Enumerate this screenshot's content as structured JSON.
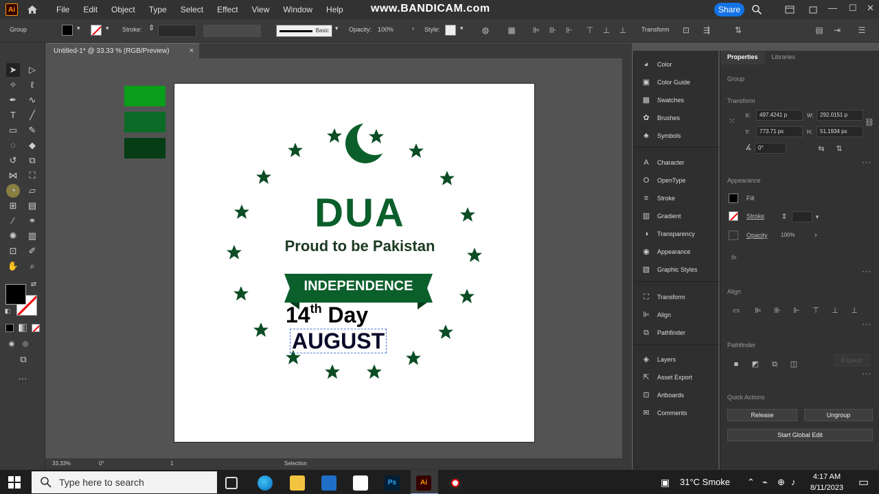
{
  "app": {
    "logo": "Ai",
    "menu": [
      "File",
      "Edit",
      "Object",
      "Type",
      "Select",
      "Effect",
      "View",
      "Window",
      "Help"
    ],
    "watermark": "www.BANDICAM.com",
    "share": "Share"
  },
  "control": {
    "selection": "Group",
    "stroke_label": "Stroke:",
    "brush": "Basic",
    "opacity_label": "Opacity:",
    "opacity": "100%",
    "style_label": "Style:",
    "transform": "Transform"
  },
  "document": {
    "tab_title": "Untitled-1* @ 33.33 % (RGB/Preview)",
    "close": "×"
  },
  "artwork": {
    "title": "DUA",
    "subtitle": "Proud to be Pakistan",
    "banner": "INDEPENDENCE",
    "day_number": "14",
    "day_suffix": "th",
    "day_word": "Day",
    "month": "AUGUST",
    "colors": {
      "green": "#0b5f2b",
      "swatch1": "#0a9d1a",
      "swatch2": "#0c6b27",
      "swatch3": "#063d15"
    }
  },
  "status": {
    "zoom": "33.33%",
    "rotation": "0°",
    "artboard": "1",
    "tool": "Selection"
  },
  "panels": [
    {
      "icon": "color-icon",
      "label": "Color"
    },
    {
      "icon": "color-guide-icon",
      "label": "Color Guide"
    },
    {
      "icon": "swatches-icon",
      "label": "Swatches"
    },
    {
      "icon": "brushes-icon",
      "label": "Brushes"
    },
    {
      "icon": "symbols-icon",
      "label": "Symbols"
    },
    {
      "icon": "character-icon",
      "label": "Character"
    },
    {
      "icon": "opentype-icon",
      "label": "OpenType"
    },
    {
      "icon": "stroke-icon",
      "label": "Stroke"
    },
    {
      "icon": "gradient-icon",
      "label": "Gradient"
    },
    {
      "icon": "transparency-icon",
      "label": "Transparency"
    },
    {
      "icon": "appearance-icon",
      "label": "Appearance"
    },
    {
      "icon": "graphic-styles-icon",
      "label": "Graphic Styles"
    },
    {
      "icon": "transform-icon",
      "label": "Transform"
    },
    {
      "icon": "align-icon",
      "label": "Align"
    },
    {
      "icon": "pathfinder-icon",
      "label": "Pathfinder"
    },
    {
      "icon": "layers-icon",
      "label": "Layers"
    },
    {
      "icon": "asset-export-icon",
      "label": "Asset Export"
    },
    {
      "icon": "artboards-icon",
      "label": "Artboards"
    },
    {
      "icon": "comments-icon",
      "label": "Comments"
    }
  ],
  "properties": {
    "tab_properties": "Properties",
    "tab_libraries": "Libraries",
    "group": "Group",
    "transform": "Transform",
    "x_label": "X:",
    "x": "497.4241 p",
    "y_label": "Y:",
    "y": "773.71 px",
    "w_label": "W:",
    "w": "292.0151 p",
    "h_label": "H:",
    "h": "51.1934 px",
    "angle": "0°",
    "appearance": "Appearance",
    "fill": "Fill",
    "stroke": "Stroke",
    "opacity": "Opacity",
    "opacity_value": "100%",
    "fx": "fx.",
    "align": "Align",
    "pathfinder": "Pathfinder",
    "expand": "Expand",
    "quick_actions": "Quick Actions",
    "release": "Release",
    "ungroup": "Ungroup",
    "global_edit": "Start Global Edit"
  },
  "taskbar": {
    "search_placeholder": "Type here to search",
    "weather": "31°C  Smoke",
    "time": "4:17 AM",
    "date": "8/11/2023"
  }
}
